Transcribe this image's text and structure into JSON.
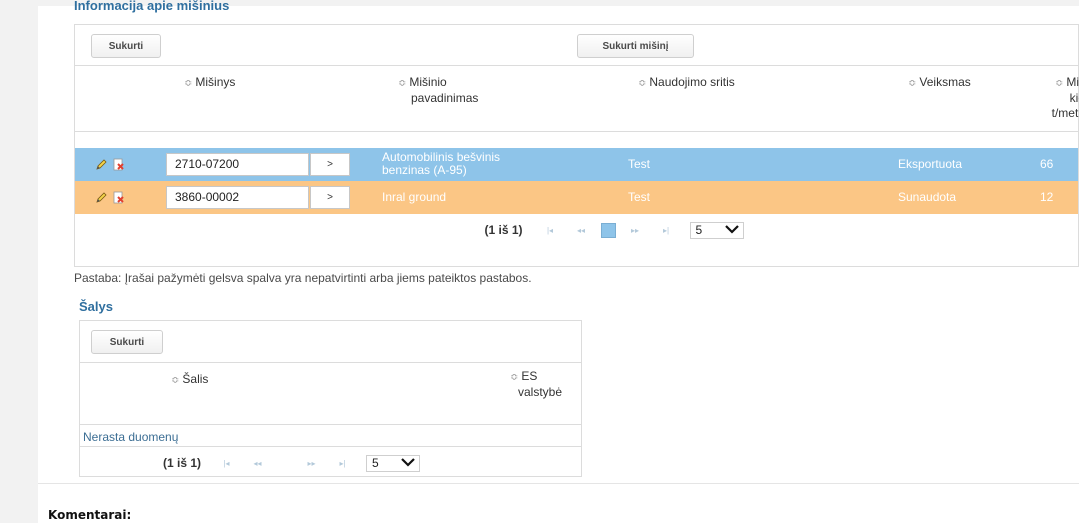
{
  "mixtures_section": {
    "title": "Informacija apie mišinius",
    "create_label": "Sukurti",
    "create_mix_label": "Sukurti mišinį",
    "columns": [
      "Mišinys",
      "Mišinio pavadinimas",
      "Naudojimo sritis",
      "Veiksmas",
      "Mišinio kiekis t/metus"
    ],
    "column_misinio_line1": "Mišinio",
    "column_misinio_line2": "pavadinimas",
    "column_kiekis_line1": "Miš",
    "column_kiekis_line2": "kie",
    "column_kiekis_line3": "t/metu",
    "rows": [
      {
        "code": "2710-07200",
        "go": ">",
        "name_line1": "Automobilinis bešvinis",
        "name_line2": "benzinas (A-95)",
        "area": "Test",
        "action": "Eksportuota",
        "qty": "66",
        "color": "#8ec4e9"
      },
      {
        "code": "3860-00002",
        "go": ">",
        "name_line1": "Inral ground",
        "name_line2": "",
        "area": "Test",
        "action": "Sunaudota",
        "qty": "12",
        "color": "#fbc685"
      }
    ],
    "pager": {
      "count": "(1 iš 1)",
      "first": "|◂",
      "prev": "◂◂",
      "page": "1",
      "next": "▸▸",
      "last": "▸|",
      "per_page": "5"
    }
  },
  "note": "Pastaba: Įrašai pažymėti gelsva spalva yra nepatvirtinti arba jiems pateiktos pastabos.",
  "countries_section": {
    "title": "Šalys",
    "create_label": "Sukurti",
    "col_country": "Šalis",
    "col_eu_line1": "ES",
    "col_eu_line2": "valstybė",
    "empty": "Nerasta duomenų",
    "pager": {
      "count": "(1 iš 1)",
      "first": "|◂",
      "prev": "◂◂",
      "next": "▸▸",
      "last": "▸|",
      "per_page": "5"
    }
  },
  "comments_label": "Komentarai:",
  "icons": {
    "edit": "pencil-icon",
    "delete": "delete-doc-icon",
    "sort": "sort-arrows-icon",
    "dropdown": "chevron-down-icon"
  }
}
